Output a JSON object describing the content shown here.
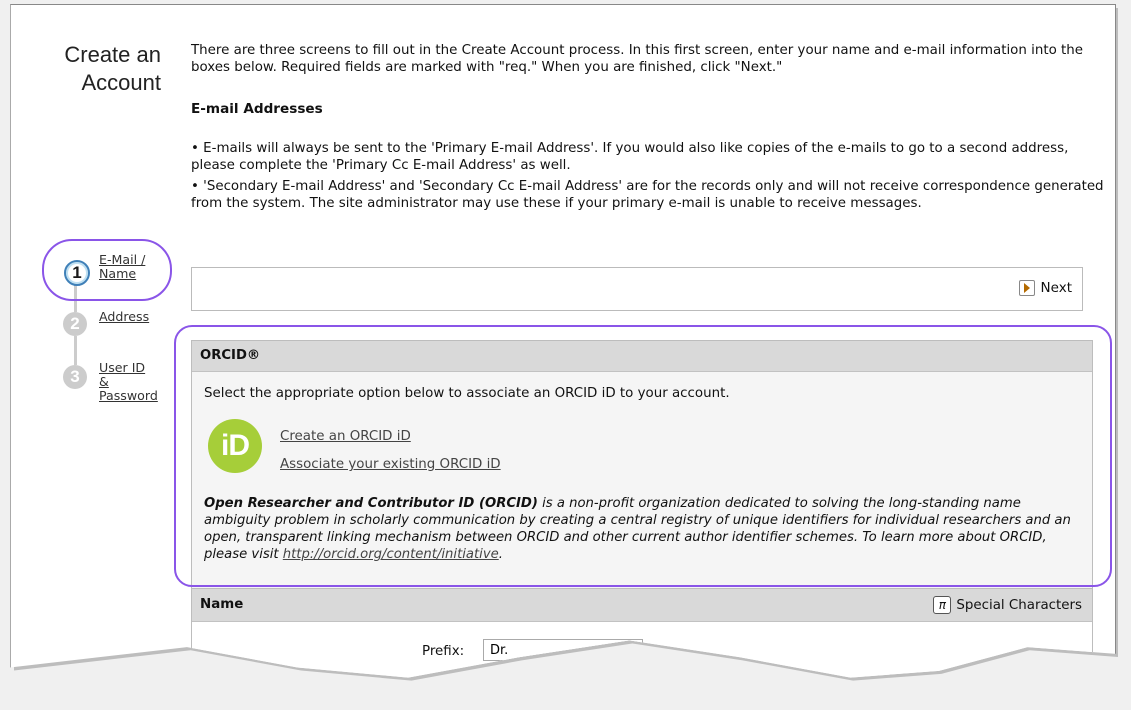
{
  "page": {
    "title_line1": "Create an",
    "title_line2": "Account",
    "intro": "There are three screens to fill out in the Create Account process. In this first screen, enter your name and e-mail information into the boxes below. Required fields are marked with \"req.\" When you are finished, click \"Next.\"",
    "email_heading": "E-mail Addresses",
    "bullet1": "•  E-mails will always be sent to the 'Primary E-mail Address'. If you would also like copies of the e-mails to go to a second address, please complete the 'Primary Cc E-mail Address' as well.",
    "bullet2": "•  'Secondary E-mail Address' and 'Secondary Cc E-mail Address' are for the records only and will not receive correspondence generated from the system. The site administrator may use these if your primary e-mail is unable to receive messages."
  },
  "steps": [
    {
      "number": "1",
      "label_line1": "E-Mail /",
      "label_line2": "Name",
      "active": true
    },
    {
      "number": "2",
      "label_line1": "Address",
      "label_line2": ""
    },
    {
      "number": "3",
      "label_line1": "User ID",
      "label_line2": "&",
      "label_line3": "Password"
    }
  ],
  "nav": {
    "next_label": "Next"
  },
  "orcid": {
    "title": "ORCID®",
    "instructions": "Select the appropriate option below to associate an ORCID iD to your account.",
    "logo_text": "iD",
    "create_link": "Create an ORCID iD",
    "associate_link": "Associate your existing ORCID iD",
    "desc_bold": "Open Researcher and Contributor ID (ORCID)",
    "desc_text": " is a non-profit organization dedicated to solving the long-standing name ambiguity problem in scholarly communication by creating a central registry of unique identifiers for individual researchers and an open, transparent linking mechanism between ORCID and other current author identifier schemes. To learn more about ORCID, please visit ",
    "desc_url": "http://orcid.org/content/initiative",
    "desc_end": "."
  },
  "name_section": {
    "title": "Name",
    "special_chars_label": "Special Characters",
    "special_chars_icon": "π",
    "prefix_label": "Prefix:",
    "prefix_value": "Dr."
  },
  "colors": {
    "highlight": "#8a55e8",
    "orcid_green": "#a6ce39",
    "header_gray": "#d9d9d9"
  }
}
